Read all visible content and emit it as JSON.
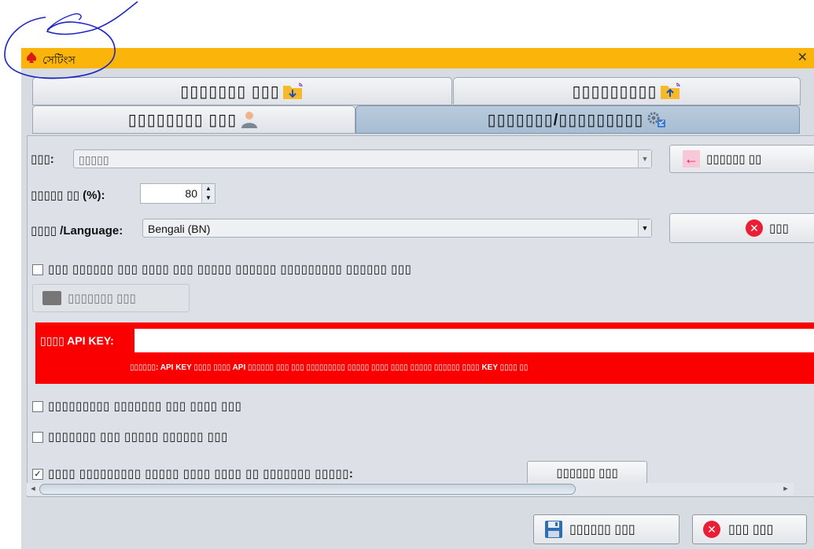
{
  "window": {
    "title": "সেটিংস"
  },
  "tabs": {
    "row1_left": "▯▯▯▯▯▯▯ ▯▯▯",
    "row1_right": "▯▯▯▯▯▯▯▯▯",
    "row2_left": "▯▯▯▯▯▯▯▯ ▯▯▯",
    "row2_right": "▯▯▯▯▯▯▯/▯▯▯▯▯▯▯▯▯"
  },
  "form": {
    "theme_label": "▯▯▯:",
    "theme_value": "▯▯▯▯▯",
    "back_button": "▯▯▯▯▯▯ ▯▯",
    "scale_label": "▯▯▯▯▯ ▯▯ (%):",
    "scale_value": "80",
    "language_label": "▯▯▯▯ /Language:",
    "language_value": "Bengali (BN)",
    "reset_button": "▯▯▯",
    "folder_checkbox_label": "▯▯▯ ▯▯▯▯▯▯ ▯▯▯ ▯▯▯▯ ▯▯▯ ▯▯▯▯▯ ▯▯▯▯▯▯ ▯▯▯▯▯▯▯▯▯ ▯▯▯▯▯▯ ▯▯▯",
    "folder_button": "▯▯▯▯▯▯▯ ▯▯▯",
    "api_label": "▯▯▯▯ API KEY:",
    "api_value": "",
    "api_note": "▯▯▯▯▯▯: API KEY ▯▯▯▯ ▯▯▯▯ API ▯▯▯▯▯▯ ▯▯▯ ▯▯▯ ▯▯▯▯▯▯▯▯▯ ▯▯▯▯▯ ▯▯▯▯ ▯▯▯▯ ▯▯▯▯▯ ▯▯▯▯▯▯ ▯▯▯▯ KEY ▯▯▯▯ ▯▯",
    "check1_label": "▯▯▯▯▯▯▯▯▯ ▯▯▯▯▯▯▯ ▯▯▯ ▯▯▯▯ ▯▯▯",
    "check2_label": "▯▯▯▯▯▯▯ ▯▯▯ ▯▯▯▯▯ ▯▯▯▯▯▯ ▯▯▯",
    "check3_label": "▯▯▯▯ ▯▯▯▯▯▯▯▯▯ ▯▯▯▯▯ ▯▯▯▯ ▯▯▯▯ ▯▯ ▯▯▯▯▯▯▯ ▯▯▯▯▯:",
    "check3_button": "▯▯▯▯▯▯ ▯▯▯"
  },
  "footer": {
    "save_button": "▯▯▯▯▯▯ ▯▯▯",
    "cancel_button": "▯▯▯ ▯▯▯"
  },
  "colors": {
    "titlebar": "#fbb40a",
    "api_box": "#fb0000",
    "active_tab": "#a7bdd3"
  }
}
